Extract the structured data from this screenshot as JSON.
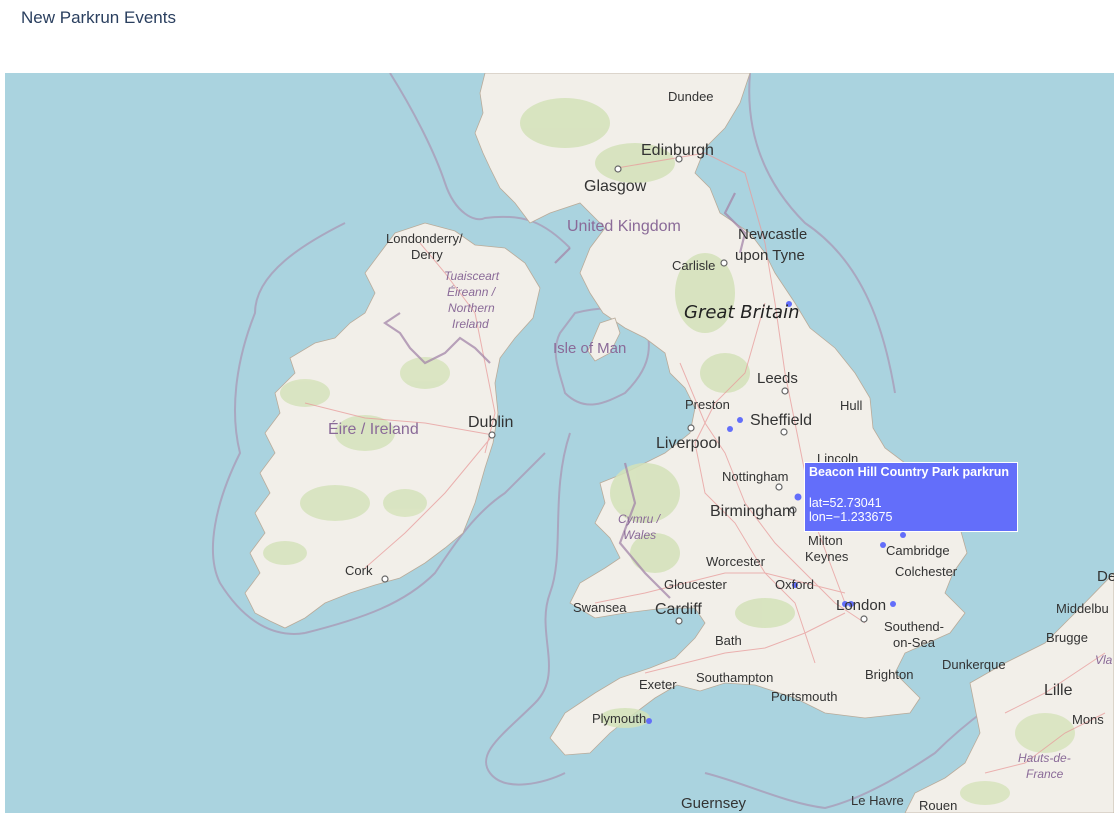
{
  "page": {
    "title": "New Parkrun Events"
  },
  "map": {
    "basemap": "OpenStreetMap",
    "marker_color": "#636efa",
    "labels": {
      "dundee": "Dundee",
      "edinburgh": "Edinburgh",
      "glasgow": "Glasgow",
      "united_kingdom": "United Kingdom",
      "newcastle_1": "Newcastle",
      "newcastle_2": "upon Tyne",
      "carlisle": "Carlisle",
      "londonderry_1": "Londonderry/",
      "londonderry_2": "Derry",
      "ni_1": "Tuaisceart",
      "ni_2": "Éireann /",
      "ni_3": "Northern",
      "ni_4": "Ireland",
      "great_britain": "Great Britain",
      "isle_of_man": "Isle of Man",
      "leeds": "Leeds",
      "preston": "Preston",
      "sheffield": "Sheffield",
      "hull": "Hull",
      "liverpool": "Liverpool",
      "eire": "Éire / Ireland",
      "dublin": "Dublin",
      "lincoln": "Lincoln",
      "nottingham": "Nottingham",
      "birmingham": "Birmingham",
      "cymru_1": "Cymru /",
      "cymru_2": "Wales",
      "milton_1": "Milton",
      "milton_2": "Keynes",
      "cambridge": "Cambridge",
      "cork": "Cork",
      "worcester": "Worcester",
      "colchester": "Colchester",
      "gloucester": "Gloucester",
      "oxford": "Oxford",
      "swansea": "Swansea",
      "cardiff": "Cardiff",
      "london": "London",
      "southend_1": "Southend-",
      "southend_2": "on-Sea",
      "bath": "Bath",
      "dunkerque": "Dunkerque",
      "exeter": "Exeter",
      "southampton": "Southampton",
      "brighton": "Brighton",
      "portsmouth": "Portsmouth",
      "plymouth": "Plymouth",
      "guernsey": "Guernsey",
      "le_havre": "Le Havre",
      "rouen": "Rouen",
      "lille": "Lille",
      "brugge": "Brugge",
      "middelburg": "Middelbu",
      "mons": "Mons",
      "hauts_1": "Hauts-de-",
      "hauts_2": "France",
      "de": "De",
      "vla": "Vla"
    }
  },
  "tooltip": {
    "name": "Beacon Hill Country Park parkrun",
    "lat": "lat=52.73041",
    "lon": "lon=−1.233675"
  }
}
